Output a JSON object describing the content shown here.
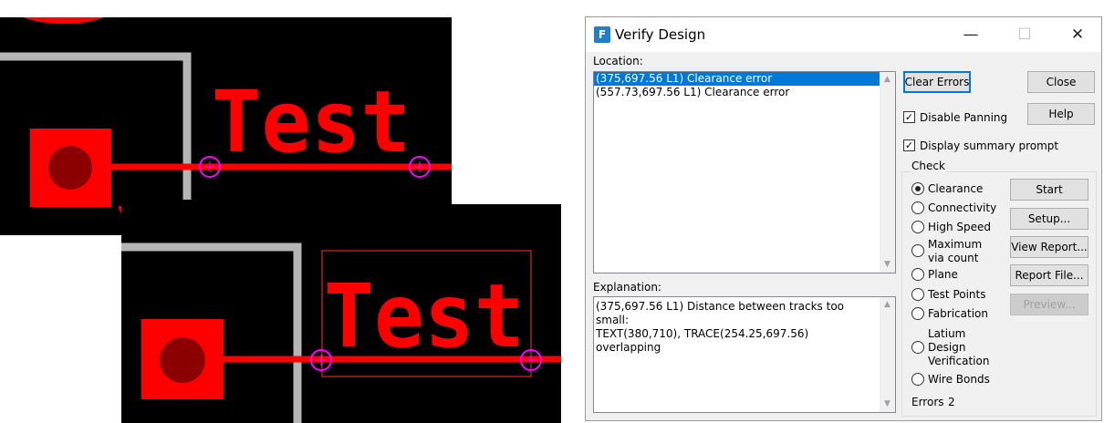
{
  "pcb_top": {
    "text": "Test"
  },
  "pcb_bottom": {
    "text": "Test"
  },
  "dialog": {
    "title": "Verify Design",
    "app_icon_glyph": "F",
    "minimize_glyph": "—",
    "maximize_glyph": "☐",
    "close_glyph": "✕",
    "location_label": "Location:",
    "location_items": [
      {
        "text": "(375,697.56 L1) Clearance error",
        "selected": true
      },
      {
        "text": "(557.73,697.56 L1) Clearance error",
        "selected": false
      }
    ],
    "scroll_up_glyph": "▲",
    "scroll_down_glyph": "▼",
    "explanation_label": "Explanation:",
    "explanation_text": "(375,697.56 L1) Distance between tracks too small:\nTEXT(380,710), TRACE(254.25,697.56) overlapping",
    "buttons": {
      "clear_errors": "Clear Errors",
      "close": "Close",
      "help": "Help",
      "start": "Start",
      "setup": "Setup...",
      "view_report": "View Report...",
      "report_file": "Report File...",
      "preview": "Preview..."
    },
    "check_mark": "✓",
    "options": {
      "disable_panning": {
        "label": "Disable Panning",
        "checked": true
      },
      "display_summary": {
        "label": "Display summary prompt",
        "checked": true
      }
    },
    "check_group_label": "Check",
    "checks": {
      "clearance": "Clearance",
      "connectivity": "Connectivity",
      "high_speed": "High Speed",
      "max_via_1": "Maximum",
      "max_via_2": "via count",
      "plane": "Plane",
      "test_points": "Test Points",
      "fabrication": "Fabrication",
      "latium_1": "Latium",
      "latium_2": "Design",
      "latium_3": "Verification",
      "wire_bonds": "Wire Bonds"
    },
    "selected_check": "Clearance",
    "errors_label": "Errors",
    "errors_count": "2"
  }
}
